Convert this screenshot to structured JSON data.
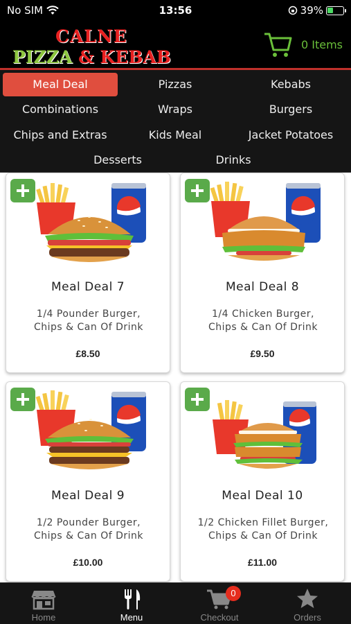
{
  "status_bar": {
    "carrier": "No SIM",
    "time": "13:56",
    "battery": "39%",
    "battery_fill": 0.39
  },
  "header": {
    "logo_line1": "CALNE",
    "logo_line2a": "PIZZA",
    "logo_line2b": "&",
    "logo_line2c": "KEBAB",
    "cart_label": "0 Items"
  },
  "categories": [
    {
      "label": "Meal Deal",
      "active": true
    },
    {
      "label": "Pizzas"
    },
    {
      "label": "Kebabs"
    },
    {
      "label": "Combinations"
    },
    {
      "label": "Wraps"
    },
    {
      "label": "Burgers"
    },
    {
      "label": "Chips and Extras"
    },
    {
      "label": "Kids Meal"
    },
    {
      "label": "Jacket Potatoes"
    },
    {
      "label": "Desserts"
    },
    {
      "label": "Drinks"
    }
  ],
  "products": [
    {
      "title": "Meal Deal 7",
      "desc1": "1/4 Pounder Burger,",
      "desc2": "Chips & Can Of Drink",
      "price": "£8.50",
      "image": "beef-burger-meal"
    },
    {
      "title": "Meal Deal 8",
      "desc1": "1/4 Chicken Burger,",
      "desc2": "Chips & Can Of Drink",
      "price": "£9.50",
      "image": "chicken-burger-meal"
    },
    {
      "title": "Meal Deal 9",
      "desc1": "1/2 Pounder Burger,",
      "desc2": "Chips & Can Of Drink",
      "price": "£10.00",
      "image": "double-beef-burger-meal"
    },
    {
      "title": "Meal Deal 10",
      "desc1": "1/2 Chicken Fillet Burger,",
      "desc2": "Chips & Can Of Drink",
      "price": "£11.00",
      "image": "double-chicken-burger-meal"
    }
  ],
  "tabs": [
    {
      "label": "Home",
      "icon": "store-icon"
    },
    {
      "label": "Menu",
      "icon": "fork-knife-icon",
      "active": true
    },
    {
      "label": "Checkout",
      "icon": "cart-icon",
      "badge": "0"
    },
    {
      "label": "Orders",
      "icon": "star-icon"
    }
  ],
  "colors": {
    "accent": "#e04e3e",
    "cart_green": "#6abf3a",
    "add_green": "#5aaa4a",
    "badge_red": "#e52d1e"
  }
}
